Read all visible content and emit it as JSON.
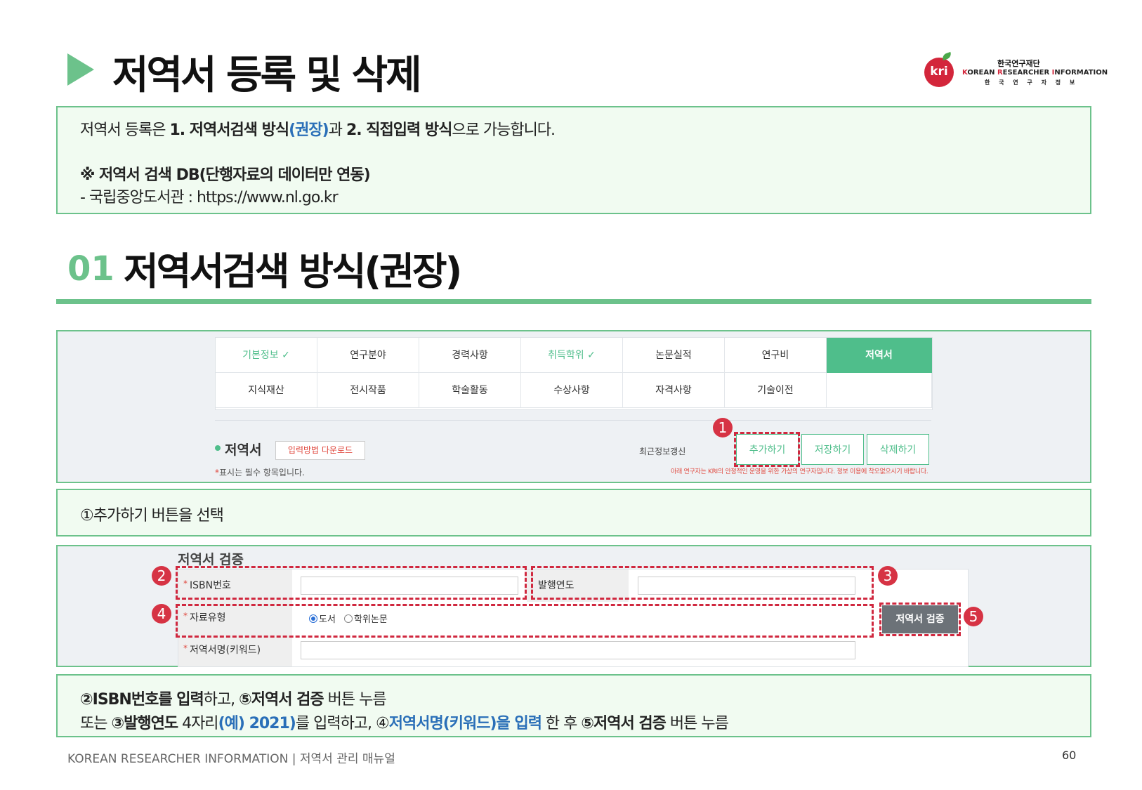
{
  "header": {
    "title": "저역서 등록 및 삭제",
    "logo": {
      "mark": "kri",
      "korean": "한국연구재단",
      "english_1": "K",
      "english_2": "OREAN ",
      "english_3": "R",
      "english_4": "ESEARCHER ",
      "english_5": "I",
      "english_6": "NFORMATION",
      "spaced": "한 국 연 구 자 정 보"
    }
  },
  "intro": {
    "line1_a": "저역서 등록은 ",
    "line1_b": "1. 저역서검색 방식",
    "line1_c": "(권장)",
    "line1_d": "과 ",
    "line1_e": "2. 직접입력 방식",
    "line1_f": "으로 가능합니다.",
    "line2": "※ 저역서 검색 DB(단행자료의 데이터만 연동)",
    "line3": " - 국립중앙도서관 : https://www.nl.go.kr"
  },
  "section": {
    "number": "01",
    "title": "저역서검색 방식(권장)"
  },
  "tabs": {
    "row1": [
      "기본정보 ✓",
      "연구분야",
      "경력사항",
      "취득학위 ✓",
      "논문실적",
      "연구비",
      "저역서"
    ],
    "row2": [
      "지식재산",
      "전시작품",
      "학술활동",
      "수상사항",
      "자격사항",
      "기술이전",
      ""
    ]
  },
  "panel1": {
    "section_label": "저역서",
    "download_button": "입력방법 다운로드",
    "recent_update": "최근정보갱신",
    "add_button": "추가하기",
    "save_button": "저장하기",
    "delete_button": "삭제하기",
    "required_star": "*",
    "required_note": "표시는 필수 항목입니다.",
    "warning": "아래 연구자는 KRI의 안정적인 운영을 위한 가상의 연구자입니다. 정보 이용에 착오없으시기 바랍니다."
  },
  "markers": [
    "1",
    "2",
    "3",
    "4",
    "5"
  ],
  "step1": {
    "text": "①추가하기 버튼을 선택"
  },
  "form": {
    "title": "저역서 검증",
    "isbn_label": "ISBN번호",
    "year_label": "발행연도",
    "type_label": "자료유형",
    "type_option1": "도서",
    "type_option2": "학위논문",
    "name_label": "저역서명(키워드)",
    "star": "*",
    "verify_button": "저역서 검증"
  },
  "step2": {
    "l1_a": "②ISBN번호를 입력",
    "l1_b": "하고, ",
    "l1_c": "⑤저역서 검증",
    "l1_d": " 버튼 누름",
    "l2_a": "또는 ",
    "l2_b": "③발행연도",
    "l2_c": " 4자리",
    "l2_d": "(예) 2021)",
    "l2_e": "를 입력하고, ④",
    "l2_f": "저역서명(키워드)을 입력",
    "l2_g": " 한 후 ",
    "l2_h": "⑤저역서 검증",
    "l2_i": " 버튼 누름"
  },
  "footer": {
    "text": "KOREAN RESEARCHER INFORMATION  |  저역서 관리 매뉴얼",
    "page": "60"
  },
  "colors": {
    "green": "#6cc28b",
    "tab_green": "#4fbe8b",
    "red": "#d0283f",
    "blue": "#2a6fb8"
  }
}
